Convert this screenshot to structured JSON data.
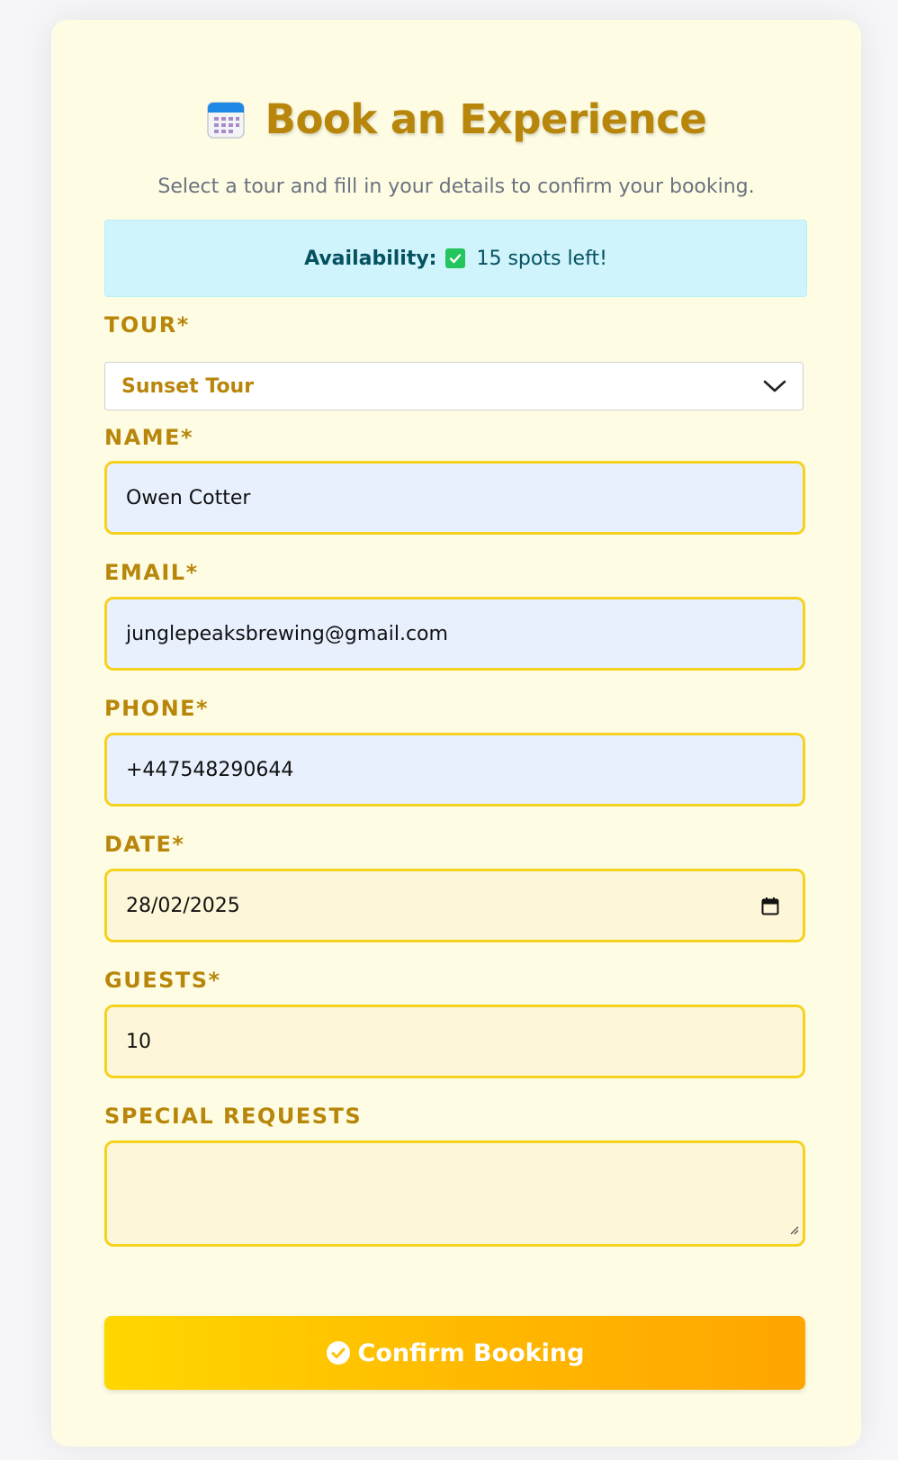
{
  "header": {
    "title": "Book an Experience",
    "subtitle": "Select a tour and fill in your details to confirm your booking."
  },
  "availability": {
    "label": "Availability:",
    "text": "15 spots left!"
  },
  "form": {
    "tour": {
      "label": "TOUR*",
      "value": "Sunset Tour"
    },
    "name": {
      "label": "NAME*",
      "value": "Owen Cotter"
    },
    "email": {
      "label": "EMAIL*",
      "value": "junglepeaksbrewing@gmail.com"
    },
    "phone": {
      "label": "PHONE*",
      "value": "+447548290644"
    },
    "date": {
      "label": "DATE*",
      "value": "28/02/2025"
    },
    "guests": {
      "label": "GUESTS*",
      "value": "10"
    },
    "special_requests": {
      "label": "SPECIAL REQUESTS",
      "value": ""
    }
  },
  "submit": {
    "label": "Confirm Booking"
  },
  "icons": {
    "title": "calendar-icon",
    "availability": "checkbox-check-icon",
    "tour": "chevron-down-icon",
    "date": "calendar-picker-icon",
    "submit": "check-circle-icon"
  },
  "colors": {
    "accent": "#b8860b",
    "card_bg": "#fefde3",
    "input_border": "#f5d21f",
    "availability_bg": "#cff4fc",
    "button_start": "#ffd700",
    "button_end": "#ffa500"
  }
}
